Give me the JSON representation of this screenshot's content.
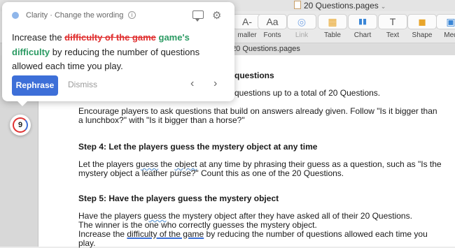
{
  "window": {
    "document_title": "20 Questions.pages",
    "tab_title": "20 Questions.pages"
  },
  "toolbar": {
    "items": [
      {
        "label": "maller",
        "icon_text": "A-"
      },
      {
        "label": "Fonts",
        "icon_text": "Aa"
      },
      {
        "label": "Link",
        "icon_text": "◎"
      },
      {
        "label": "Table",
        "icon_text": "▦"
      },
      {
        "label": "Chart",
        "icon_text": "▮▮"
      },
      {
        "label": "Text",
        "icon_text": "T"
      },
      {
        "label": "Shape",
        "icon_text": "◼"
      },
      {
        "label": "Med",
        "icon_text": "▣"
      }
    ]
  },
  "document": {
    "heading_fragment": "questions",
    "line1_fragment": "questions up to a total of 20 Questions.",
    "para1_line1": "Encourage players to ask questions that build on answers already given. Follow \"Is it bigger than",
    "para1_line2": "a lunchbox?\" with \"Is it bigger than a horse?\"",
    "step4_heading": "Step 4: Let the players guess the mystery object at any time",
    "step4_line1_a": "Let the players ",
    "step4_line1_b": "guess",
    "step4_line1_c": " the ",
    "step4_line1_d": "object",
    "step4_line1_e": " at any time by phrasing their guess as a question, such as \"Is the",
    "step4_line2": "mystery object a leather purse?\" Count this as one of the 20 Questions.",
    "step5_heading": "Step 5: Have the players guess the mystery object",
    "step5_line1_a": "Have the players ",
    "step5_line1_b": "guess",
    "step5_line1_c": " the mystery object after they have asked all of their 20 Questions.",
    "step5_line2": "The winner is the one who correctly guesses the mystery object.",
    "step5_line3_a": "Increase the ",
    "step5_line3_b": "difficulty of the game",
    "step5_line3_c": " by reducing the number of questions allowed each time you",
    "step5_line4": "play."
  },
  "clarity": {
    "header": "Clarity · Change the wording",
    "text_before": "Increase the ",
    "deleted": "difficulty of the game",
    "inserted": "game's difficulty",
    "text_after": "by reducing the number of questions allowed each time you play.",
    "rephrase_label": "Rephrase",
    "dismiss_label": "Dismiss",
    "prev_icon": "‹",
    "next_icon": "›",
    "count": "9"
  },
  "colors": {
    "accent": "#3d6fd8",
    "deleted": "#e03131",
    "inserted": "#2a9a62"
  }
}
